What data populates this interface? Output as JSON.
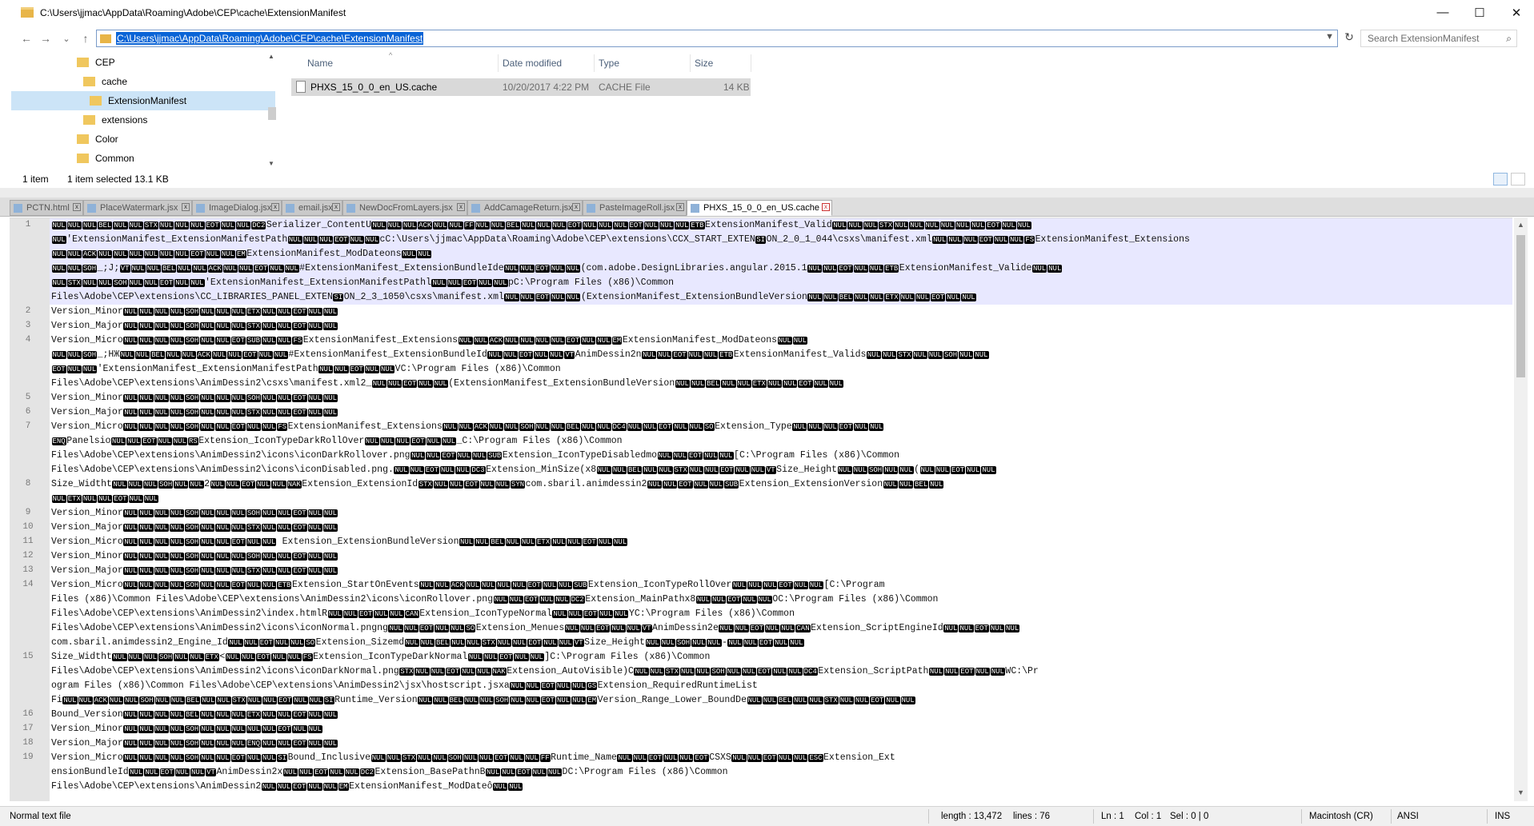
{
  "window": {
    "title": "C:\\Users\\jjmac\\AppData\\Roaming\\Adobe\\CEP\\cache\\ExtensionManifest",
    "minimize": "—",
    "maximize": "☐",
    "close": "✕"
  },
  "nav": {
    "back": "←",
    "forward": "→",
    "recent": "⌄",
    "up": "↑",
    "address": "C:\\Users\\jjmac\\AppData\\Roaming\\Adobe\\CEP\\cache\\ExtensionManifest",
    "refresh": "↻",
    "search_placeholder": "Search ExtensionManifest",
    "search_icon": "search-icon"
  },
  "tree": {
    "items": [
      {
        "label": "CEP"
      },
      {
        "label": "cache"
      },
      {
        "label": "ExtensionManifest"
      },
      {
        "label": "extensions"
      },
      {
        "label": "Color"
      },
      {
        "label": "Common"
      }
    ]
  },
  "filelist": {
    "columns": [
      "Name",
      "Date modified",
      "Type",
      "Size"
    ],
    "rows": [
      {
        "name": "PHXS_15_0_0_en_US.cache",
        "date": "10/20/2017 4:22 PM",
        "type": "CACHE File",
        "size": "14 KB"
      }
    ]
  },
  "explorer_status": {
    "count": "1 item",
    "selected": "1 item selected  13.1 KB"
  },
  "tabs": [
    {
      "label": "PCTN.html"
    },
    {
      "label": "PlaceWatermark.jsx"
    },
    {
      "label": "ImageDialog.jsx"
    },
    {
      "label": "email.jsx"
    },
    {
      "label": "NewDocFromLayers.jsx"
    },
    {
      "label": "AddCamageReturn.jsx"
    },
    {
      "label": "PasteImageRoll.jsx"
    },
    {
      "label": "PHXS_15_0_0_en_US.cache"
    }
  ],
  "editor": {
    "lines": [
      {
        "n": "1",
        "t": "NULNULNULBELNULNULSTXNULNULNULEOTNULNULDC2Serializer_ContentUNULNULNULACKNULNULFFNULNULBELNULNULNULEOTNULNULNULEOTNULNULNULETBExtensionManifest_ValidNULNULNULSTXNULNULNULNULNULNULEOTNULNUL"
      },
      {
        "n": "",
        "t": "NUL'ExtensionManifest_ExtensionManifestPathNULNULNULEOTNULNULcC:\\Users\\jjmac\\AppData\\Roaming\\Adobe\\CEP\\extensions\\CCX_START_EXTENSION_2_0_1_044\\csxs\\manifest.xmlNULNULNULEOTNULNULFSExtensionManifest_Extensions"
      },
      {
        "n": "",
        "t": "NULNULACKNULNULNULNULNULNULEOTNULNULEMExtensionManifest_ModDateonsNULNUL"
      },
      {
        "n": "",
        "t": "NULNULSOH_;J;VTNULNULBELNULNULACKNULNULEOTNULNUL#ExtensionManifest_ExtensionBundleIdeNULNULEOTNULNUL(com.adobe.DesignLibraries.angular.2015.1NULNULEOTNULNULETBExtensionManifest_ValideNULNUL"
      },
      {
        "n": "",
        "t": "NULSTXNULNULSOHNULNULEOTNULNUL'ExtensionManifest_ExtensionManifestPathlNULNULEOTNULNULpC:\\Program Files (x86)\\Common"
      },
      {
        "n": "",
        "t": "Files\\Adobe\\CEP\\extensions\\CC_LIBRARIES_PANEL_EXTENSION_2_3_1050\\csxs\\manifest.xmlNULNULEOTNULNUL(ExtensionManifest_ExtensionBundleVersionNULNULBELNULNULETXNULNULEOTNULNUL"
      },
      {
        "n": "2",
        "t": "Version_MinorNULNULNULNULSOHNULNULNULETXNULNULEOTNULNUL"
      },
      {
        "n": "3",
        "t": "Version_MajorNULNULNULNULSOHNULNULNULSTXNULNULEOTNULNUL"
      },
      {
        "n": "4",
        "t": "Version_MicroNULNULNULNULSOHNULNULEOTSUBNULNULFSExtensionManifest_ExtensionsNULNULACKNULNULNULNULEOTNULNULEMExtensionManifest_ModDateonsNULNUL"
      },
      {
        "n": "",
        "t": "NULNULSOH_;HЖNULNULBELNULNULACKNULNULEOTNULNUL#ExtensionManifest_ExtensionBundleIdNULNULEOTNULNULVTAnimDessin2nNULNULEOTNULNULETBExtensionManifest_ValidsNULNULSTXNULNULSOHNULNUL"
      },
      {
        "n": "",
        "t": "EOTNULNUL'ExtensionManifest_ExtensionManifestPathNULNULEOTNULNULVC:\\Program Files (x86)\\Common"
      },
      {
        "n": "",
        "t": "Files\\Adobe\\CEP\\extensions\\AnimDessin2\\csxs\\manifest.xml2_NULNULEOTNULNUL(ExtensionManifest_ExtensionBundleVersionNULNULBELNULNULETXNULNULEOTNULNUL"
      },
      {
        "n": "5",
        "t": "Version_MinorNULNULNULNULSOHNULNULNULSOHNULNULEOTNULNUL"
      },
      {
        "n": "6",
        "t": "Version_MajorNULNULNULNULSOHNULNULNULSTXNULNULEOTNULNUL"
      },
      {
        "n": "7",
        "t": "Version_MicroNULNULNULNULSOHNULNULEOTNULNULFSExtensionManifest_ExtensionsNULNULACKNULNULSOHNULNULBELNULNULDC4NULNULEOTNULNULSOExtension_TypeNULNULNULEOTNULNUL"
      },
      {
        "n": "",
        "t": "ENQPanelsioNULNULEOTNULNULRSExtension_IconTypeDarkRollOverNULNULNULEOTNULNUL_C:\\Program Files (x86)\\Common"
      },
      {
        "n": "",
        "t": "Files\\Adobe\\CEP\\extensions\\AnimDessin2\\icons\\iconDarkRollover.pngNULNULEOTNULNULSUBExtension_IconTypeDisabledmoNULNULEOTNULNUL[C:\\Program Files (x86)\\Common"
      },
      {
        "n": "",
        "t": "Files\\Adobe\\CEP\\extensions\\AnimDessin2\\icons\\iconDisabled.png.NULNULEOTNULNULDC3Extension_MinSize(x8NULNULBELNULNULSTXNULNULEOTNULNULVTSize_HeightNULNULSOHNULNUL(NULNULEOTNULNUL"
      },
      {
        "n": "8",
        "t": "Size_WidthtNULNULNULSOHNULNUL2NULNULEOTNULNULNAKExtension_ExtensionIdSTXNULNULEOTNULNULSYNcom.sbaril.animdessin2NULNULEOTNULNULSUBExtension_ExtensionVersionNULNULBELNUL"
      },
      {
        "n": "",
        "t": "NULETXNULNULEOTNULNUL"
      },
      {
        "n": "9",
        "t": "Version_MinorNULNULNULNULSOHNULNULNULSOHNULNULEOTNULNUL"
      },
      {
        "n": "10",
        "t": "Version_MajorNULNULNULNULSOHNULNULNULSTXNULNULEOTNULNUL"
      },
      {
        "n": "11",
        "t": "Version_MicroNULNULNULNULSOHNULNULEOTNULNUL Extension_ExtensionBundleVersionNULNULBELNULNULETXNULNULEOTNULNUL"
      },
      {
        "n": "12",
        "t": "Version_MinorNULNULNULNULSOHNULNULNULSOHNULNULEOTNULNUL"
      },
      {
        "n": "13",
        "t": "Version_MajorNULNULNULNULSOHNULNULNULSTXNULNULEOTNULNUL"
      },
      {
        "n": "14",
        "t": "Version_MicroNULNULNULNULSOHNULNULEOTNULNULETBExtension_StartOnEventsNULNULACKNULNULNULNULEOTNULNULSUBExtension_IconTypeRollOverNULNULNULEOTNULNUL[C:\\Program"
      },
      {
        "n": "",
        "t": "Files (x86)\\Common Files\\Adobe\\CEP\\extensions\\AnimDessin2\\icons\\iconRollover.pngNULNULEOTNULNULDC2Extension_MainPathx8NULNULEOTNULNULOC:\\Program Files (x86)\\Common"
      },
      {
        "n": "",
        "t": "Files\\Adobe\\CEP\\extensions\\AnimDessin2\\index.htmlRNULNULEOTNULNULCANExtension_IconTypeNormalNULNULEOTNULNULYC:\\Program Files (x86)\\Common"
      },
      {
        "n": "",
        "t": "Files\\Adobe\\CEP\\extensions\\AnimDessin2\\icons\\iconNormal.pngngNULNULEOTNULNULSOExtension_MenuesNULNULEOTNULNULVTAnimDessin2eNULNULEOTNULNULCANExtension_ScriptEngineIdNULNULEOTNULNUL"
      },
      {
        "n": "",
        "t": "com.sbaril.animdessin2_Engine_IdNULNULEOTNULNULSOExtension_SizemdNULNULBELNULNULSTXNULNULEOTNULNULVTSize_HeightNULNULSOHNULNUL-NULNULEOTNULNUL"
      },
      {
        "n": "15",
        "t": "Size_WidthtNULNULNULSOHNULNULETX<NULNULEOTNULNULFSExtension_IconTypeDarkNormalNULNULEOTNULNUL]C:\\Program Files (x86)\\Common"
      },
      {
        "n": "",
        "t": "Files\\Adobe\\CEP\\extensions\\AnimDessin2\\icons\\iconDarkNormal.pngSTXNULNULEOTNULNULNAKExtension_AutoVisible)CNULNULSTXNULNULSOHNULNULEOTNULNULDC4Extension_ScriptPathNULNULEOTNULNULWC:\\Pr"
      },
      {
        "n": "",
        "t": "ogram Files (x86)\\Common Files\\Adobe\\CEP\\extensions\\AnimDessin2\\jsx\\hostscript.jsxaNULNULEOTNULNULGSExtension_RequiredRuntimeList"
      },
      {
        "n": "",
        "t": "FiNULNULACKNULNULSOHNULNULBELNULNULSTXNULNULEOTNULNULSIRuntime_VersionNULNULBELNULNULSOHNULNULEOTNULNULEMVersion_Range_Lower_BoundDeNULNULBELNULNULSTXNULNULEOTNULNUL"
      },
      {
        "n": "16",
        "t": "Bound_VersionNULNULNULNULBELNULNULNULETXNULNULEOTNULNUL"
      },
      {
        "n": "17",
        "t": "Version_MinorNULNULNULNULSOHNULNULNULNULNULEOTNULNUL"
      },
      {
        "n": "18",
        "t": "Version_MajorNULNULNULNULSOHNULNULNULENQNULNULEOTNULNUL"
      },
      {
        "n": "19",
        "t": "Version_MicroNULNULNULNULSOHNULNULEOTNULNULSIBound_InclusiveNULNULSTXNULNULSOHNULNULEOTNULNULFFRuntime_NameNULNULEOTNULNULEOTCSXSNULNULEOTNULNULESCExtension_Ext"
      },
      {
        "n": "",
        "t": "ensionBundleIdNULNULEOTNULNULVTAnimDessin2xNULNULEOTNULNULDC2Extension_BasePathnBNULNULEOTNULNULDC:\\Program Files (x86)\\Common"
      },
      {
        "n": "",
        "t": "Files\\Adobe\\CEP\\extensions\\AnimDessin2NULNULEOTNULNULEMExtensionManifest_ModDateôNULNUL"
      }
    ]
  },
  "status": {
    "filetype": "Normal text file",
    "length": "length : 13,472",
    "lines": "lines : 76",
    "ln": "Ln : 1",
    "col": "Col : 1",
    "sel": "Sel : 0 | 0",
    "eol": "Macintosh (CR)",
    "encoding": "ANSI",
    "mode": "INS"
  }
}
